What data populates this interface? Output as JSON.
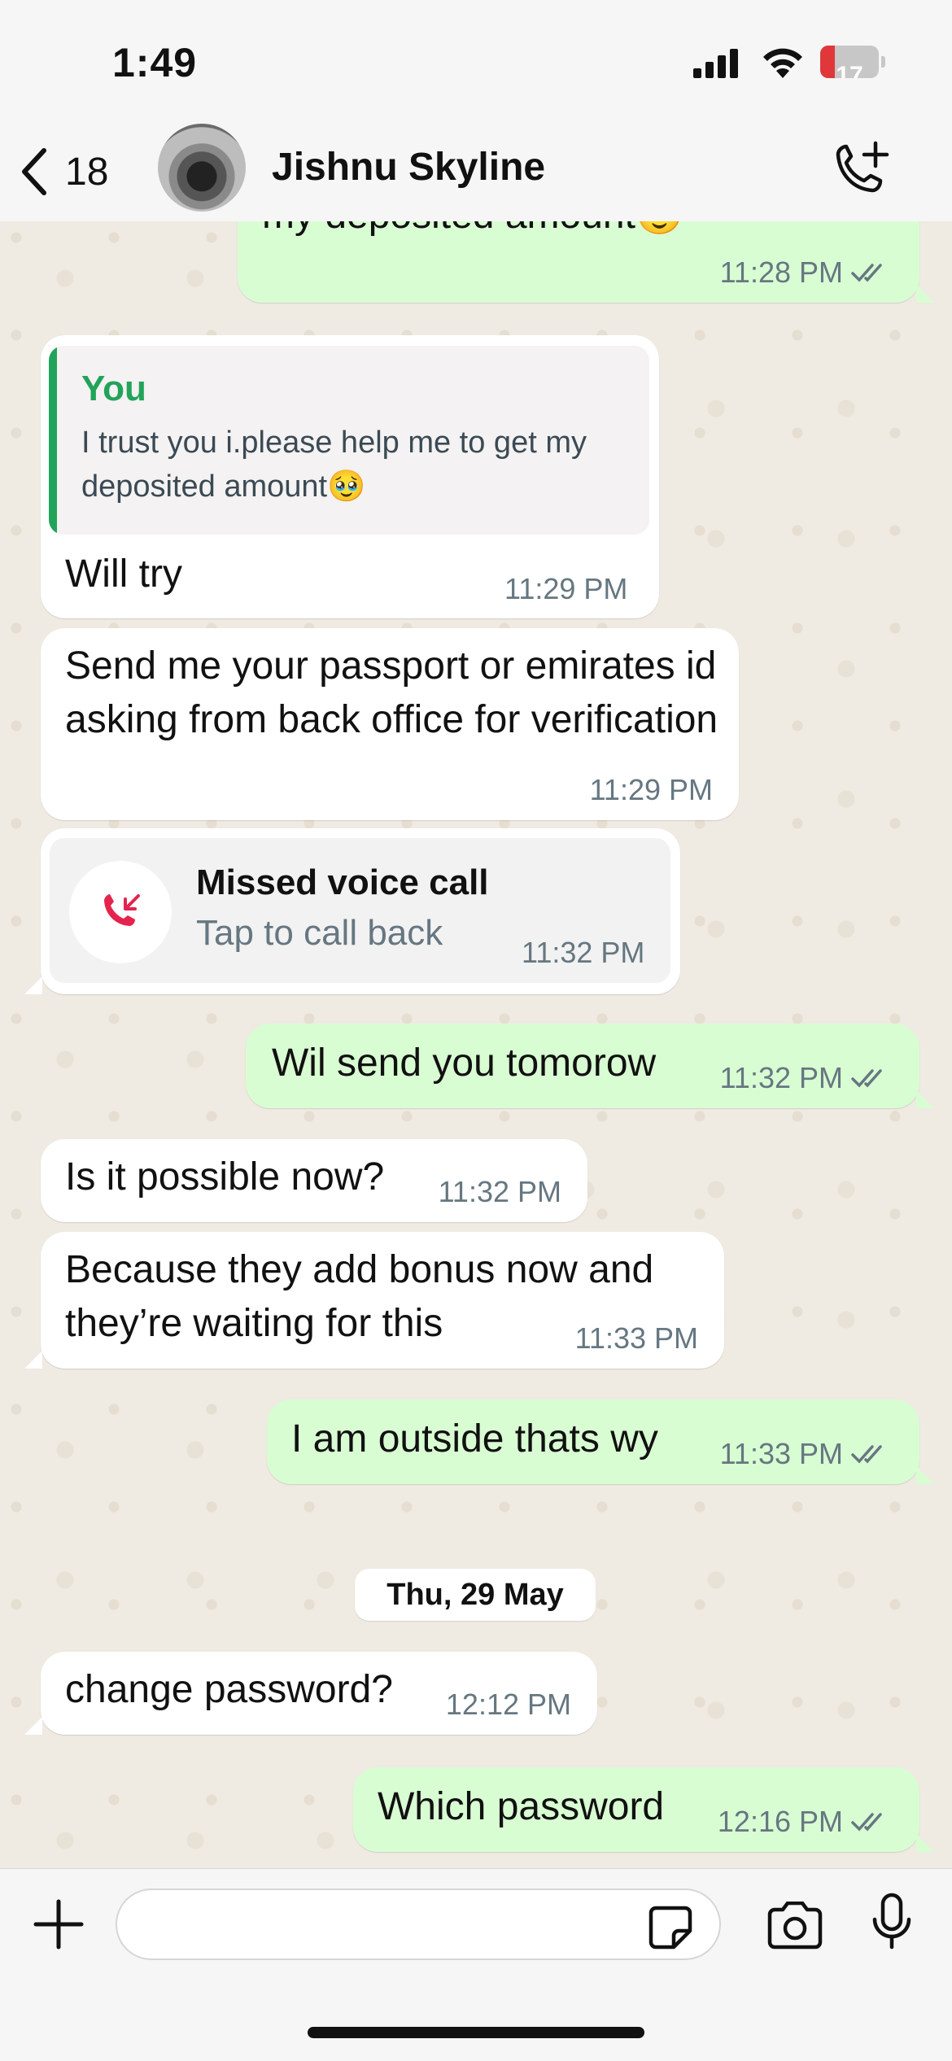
{
  "status_bar": {
    "time": "1:49",
    "battery": "17",
    "battery_level": 0.17
  },
  "header": {
    "back_count": "18",
    "contact_name": "Jishnu Skyline"
  },
  "messages": [
    {
      "id": "m0",
      "direction": "out",
      "text": "my deposited amount🥹",
      "time": "11:28 PM",
      "read": true
    },
    {
      "id": "m1",
      "direction": "in",
      "quote": {
        "author": "You",
        "text": "I trust you i.please help me to get my deposited amount🥹"
      },
      "text": "Will try",
      "time": "11:29 PM"
    },
    {
      "id": "m2",
      "direction": "in",
      "text": "Send me your passport or emirates id asking from back office for verification",
      "time": "11:29 PM"
    },
    {
      "id": "m3",
      "direction": "in",
      "type": "missed_call",
      "title": "Missed voice call",
      "subtitle": "Tap to call back",
      "time": "11:32 PM"
    },
    {
      "id": "m4",
      "direction": "out",
      "text": "Wil send you tomorow",
      "time": "11:32 PM",
      "read": true
    },
    {
      "id": "m5",
      "direction": "in",
      "text": "Is it possible now?",
      "time": "11:32 PM"
    },
    {
      "id": "m6",
      "direction": "in",
      "text": "Because they add bonus now and they’re waiting for this",
      "time": "11:33 PM"
    },
    {
      "id": "m7",
      "direction": "out",
      "text": "I am outside thats wy",
      "time": "11:33 PM",
      "read": true
    },
    {
      "id": "m8",
      "direction": "in",
      "text": "change password?",
      "time": "12:12 PM"
    },
    {
      "id": "m9",
      "direction": "out",
      "text": "Which password",
      "time": "12:16 PM",
      "read": true
    }
  ],
  "date_separator": "Thu, 29 May",
  "input": {
    "placeholder": "",
    "value": ""
  },
  "icons": {
    "back": "chevron-left-icon",
    "call": "phone-add-icon",
    "missed_call": "missed-call-icon",
    "ticks": "double-check-icon",
    "plus": "plus-icon",
    "sticker": "sticker-icon",
    "camera": "camera-icon",
    "mic": "microphone-icon"
  },
  "colors": {
    "outgoing_bubble": "#d9fdd3",
    "incoming_bubble": "#ffffff",
    "accent_green": "#22a35a",
    "read_ticks": "#53bdeb",
    "missed_call_red": "#e4244d",
    "battery_low": "#e0383a"
  }
}
